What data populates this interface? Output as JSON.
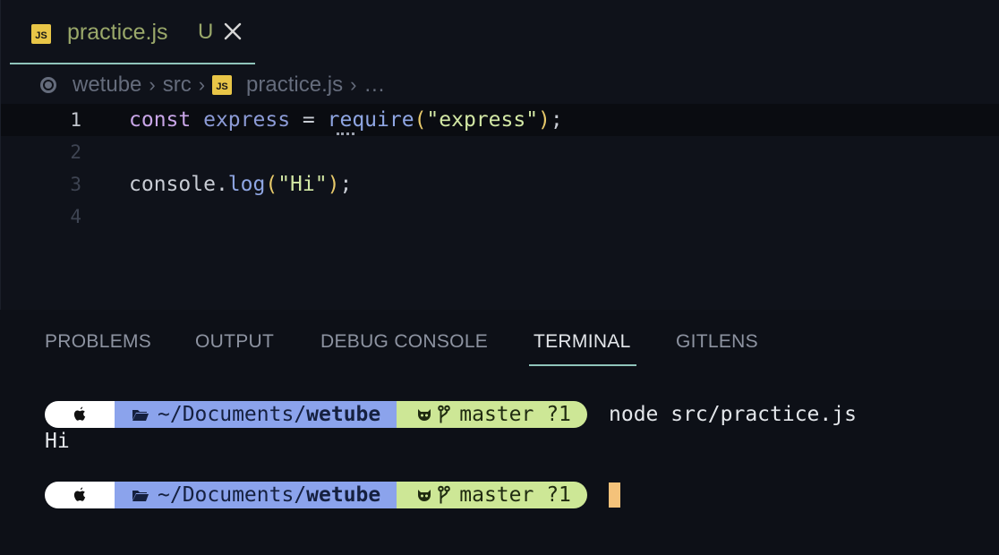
{
  "editor": {
    "tab": {
      "language_badge": "JS",
      "filename": "practice.js",
      "status": "U"
    },
    "breadcrumb": {
      "items": [
        "wetube",
        "src",
        "practice.js",
        "…"
      ],
      "file_badge": "JS"
    },
    "lines": [
      {
        "number": "1",
        "active": true
      },
      {
        "number": "2"
      },
      {
        "number": "3"
      },
      {
        "number": "4"
      }
    ],
    "code": {
      "line1": {
        "keyword": "const",
        "var": "express",
        "op": "=",
        "fn": "require",
        "open": "(",
        "string": "\"express\"",
        "close": ")",
        "semi": ";"
      },
      "line3": {
        "obj": "console",
        "dot": ".",
        "method": "log",
        "open": "(",
        "string": "\"Hi\"",
        "close": ")",
        "semi": ";"
      }
    }
  },
  "panel": {
    "tabs": [
      "PROBLEMS",
      "OUTPUT",
      "DEBUG CONSOLE",
      "TERMINAL",
      "GITLENS"
    ],
    "active_tab": "TERMINAL"
  },
  "terminal": {
    "prompt": {
      "dir_prefix": "~/Documents/",
      "dir_name": "wetube",
      "branch": "master ?1"
    },
    "command": "node src/practice.js",
    "output": "Hi"
  },
  "colors": {
    "accent": "#8fc4ba",
    "js_badge": "#e8c547",
    "dir_segment": "#8ba3ec",
    "git_segment": "#cde796",
    "cursor": "#f4c27a"
  },
  "icons": [
    "apple-icon",
    "folder-icon",
    "github-cat-icon",
    "git-branch-icon",
    "close-icon",
    "outline-circle-icon"
  ]
}
